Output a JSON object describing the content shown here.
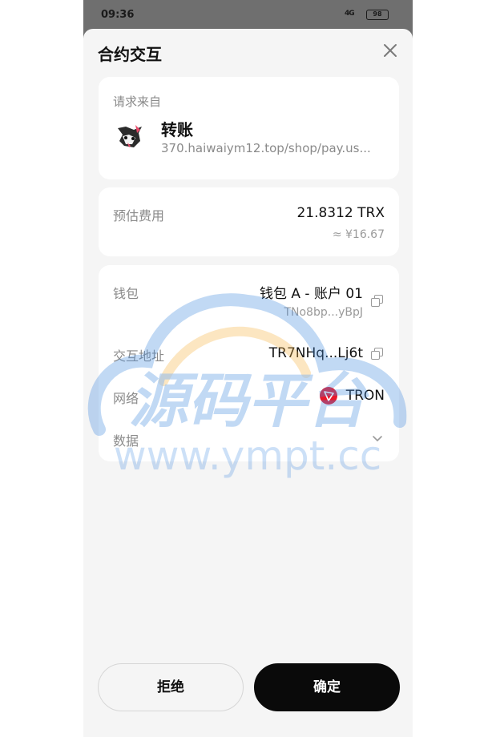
{
  "status_bar": {
    "time": "09:36",
    "signal": "4G",
    "battery": "98"
  },
  "sheet": {
    "title": "合约交互"
  },
  "request": {
    "label": "请求来自",
    "dapp_name": "转账",
    "dapp_url": "370.haiwaiym12.top/shop/pay.us..."
  },
  "fee": {
    "label": "预估费用",
    "amount": "21.8312 TRX",
    "fiat": "≈ ¥16.67"
  },
  "details": {
    "wallet_label": "钱包",
    "wallet_name": "钱包 A - 账户 01",
    "wallet_address": "TNo8bp...yBpJ",
    "contract_label": "交互地址",
    "contract_address": "TR7NHq...Lj6t",
    "network_label": "网络",
    "network_name": "TRON",
    "data_label": "数据"
  },
  "actions": {
    "reject": "拒绝",
    "confirm": "确定"
  },
  "watermark": {
    "brand": "源码平台",
    "url": "www.ympt.cc"
  },
  "colors": {
    "confirm_bg": "#0a0a0a",
    "tron_red": "#e8182c",
    "watermark_blue": "#4a8fe0",
    "watermark_orange": "#f5b64a"
  },
  "icons": {
    "close": "close-icon",
    "copy": "copy-icon",
    "chevron": "chevron-down-icon",
    "network": "tron-logo-icon"
  }
}
